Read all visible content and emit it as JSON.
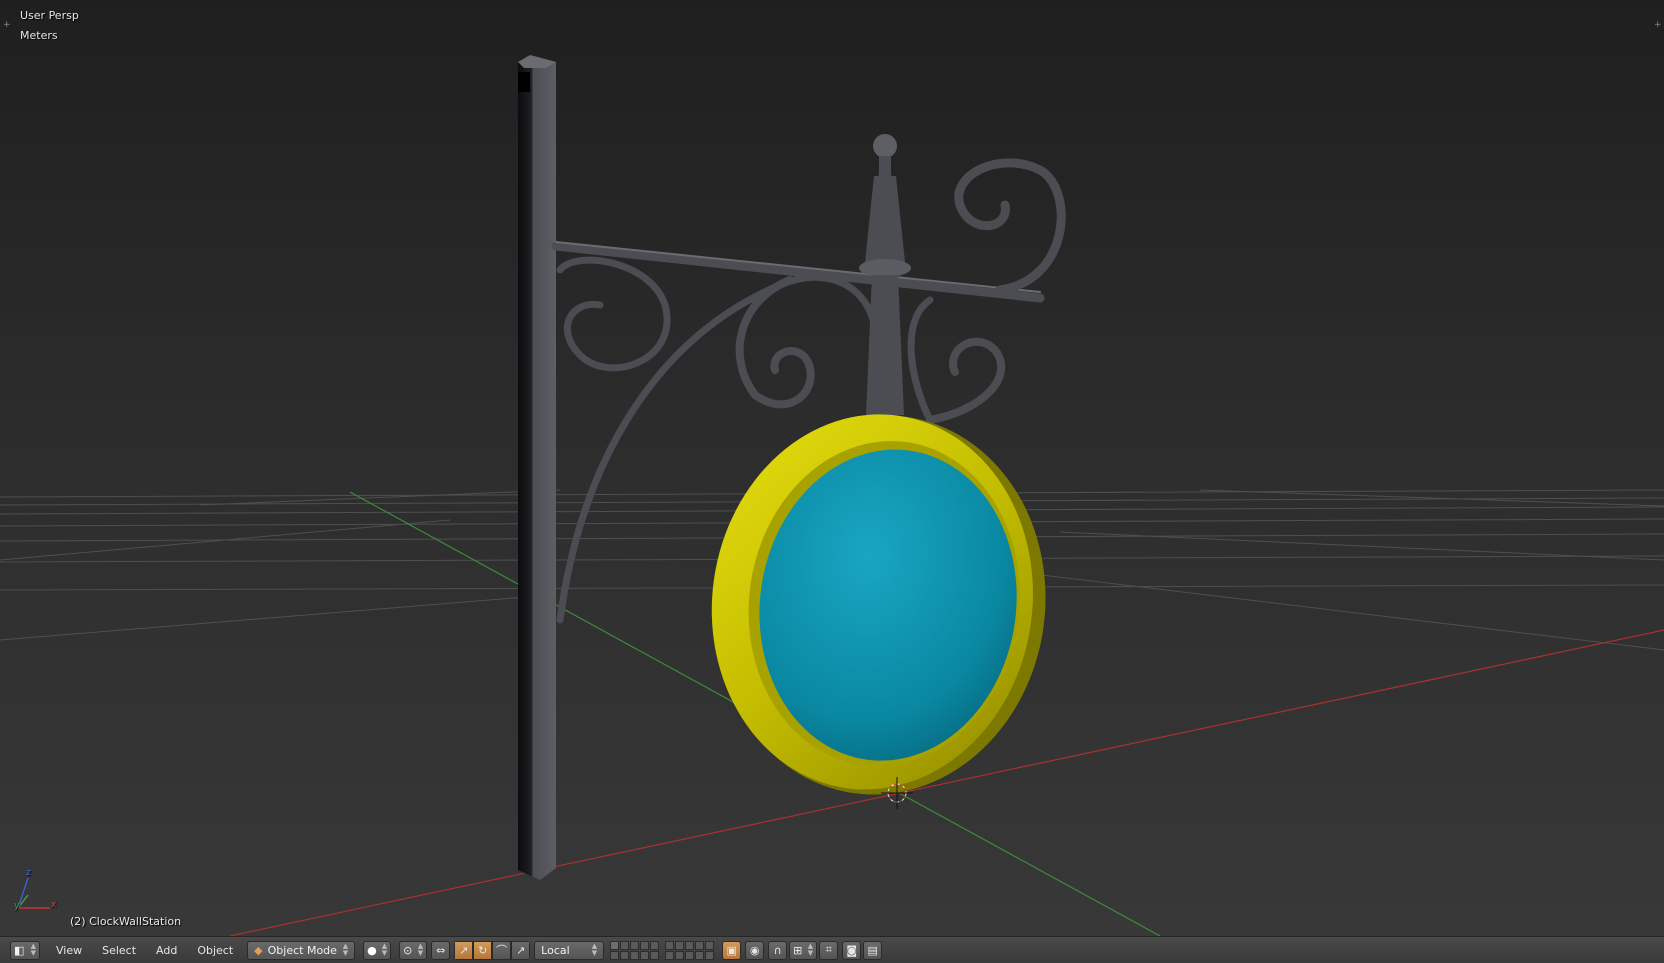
{
  "viewport": {
    "view_label": "User Persp",
    "units_label": "Meters",
    "object_label": "(2) ClockWallStation",
    "axis_labels": {
      "x": "x",
      "y": "y",
      "z": "z"
    }
  },
  "header": {
    "editor_type_icon": "3d-view-icon",
    "menus": {
      "view": "View",
      "select": "Select",
      "add": "Add",
      "object": "Object"
    },
    "mode": {
      "label": "Object Mode",
      "icon": "cube-icon"
    },
    "shading": {
      "icon": "solid-sphere-icon"
    },
    "pivot": {
      "icon": "pivot-icon"
    },
    "transform_orientation": "Local",
    "colors": {
      "accent": "#d49a5a",
      "background": "#393939"
    }
  },
  "scene": {
    "colors": {
      "frame": "#c9c400",
      "face": "#0088a4",
      "bracket": "#4b4d52",
      "x_axis": "#a83232",
      "y_axis": "#3a8c3a"
    }
  }
}
